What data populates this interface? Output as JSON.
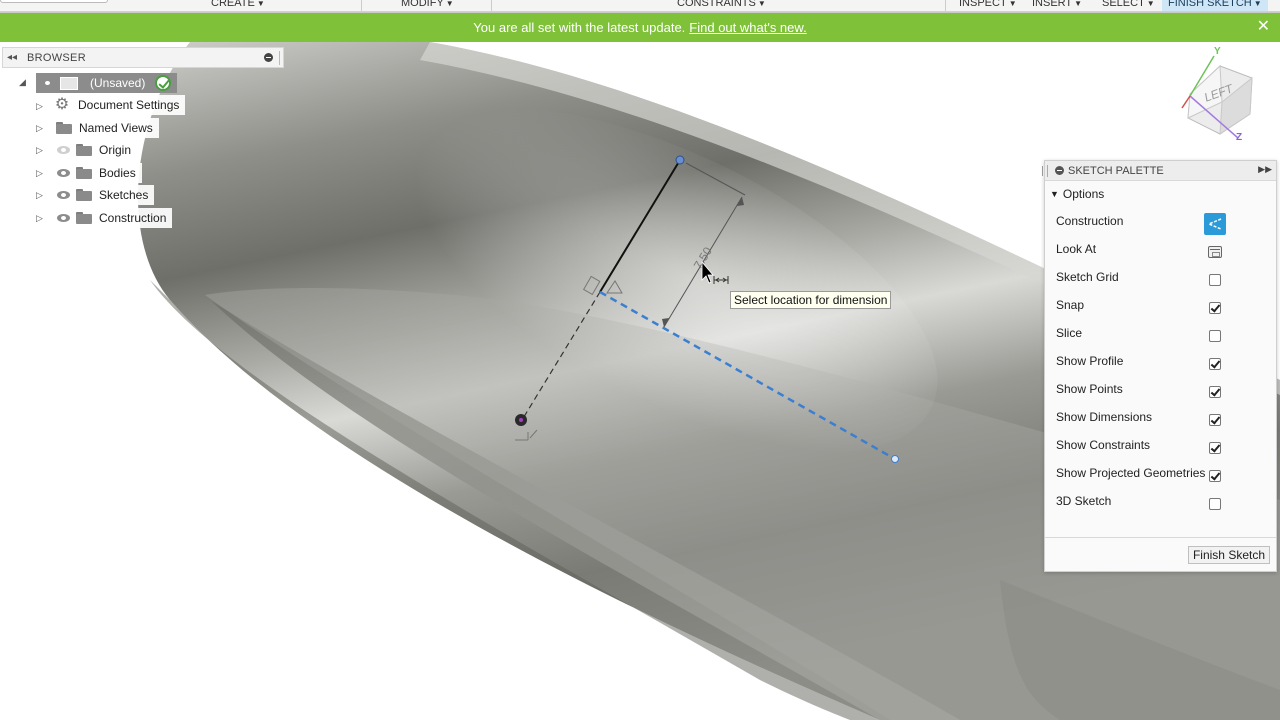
{
  "toolbar": {
    "menus": [
      {
        "label": "CREATE"
      },
      {
        "label": "MODIFY"
      },
      {
        "label": "CONSTRAINTS"
      },
      {
        "label": "INSPECT"
      },
      {
        "label": "INSERT"
      },
      {
        "label": "SELECT"
      },
      {
        "label": "FINISH SKETCH"
      }
    ]
  },
  "banner": {
    "message": "You are all set with the latest update.",
    "link": "Find out what's new.",
    "close": "✕",
    "color": "#7fc23a"
  },
  "browser": {
    "title": "BROWSER",
    "collapse_icon": "◂◂",
    "root_label": "(Unsaved)",
    "items": [
      {
        "label": "Document Settings",
        "icon": "gear-icon"
      },
      {
        "label": "Named Views",
        "icon": "folder-icon"
      },
      {
        "label": "Origin",
        "icon": "folder-icon",
        "visible": false
      },
      {
        "label": "Bodies",
        "icon": "folder-icon",
        "visible": true
      },
      {
        "label": "Sketches",
        "icon": "folder-icon",
        "visible": true
      },
      {
        "label": "Construction",
        "icon": "folder-icon",
        "visible": true
      }
    ]
  },
  "viewcube": {
    "face": "LEFT",
    "y_axis": "Y",
    "z_axis": "Z"
  },
  "dimension": {
    "value": "7.50"
  },
  "tooltip": {
    "text": "Select location for dimension"
  },
  "sketch_palette": {
    "title": "SKETCH PALETTE",
    "section": "Options",
    "options": [
      {
        "label": "Construction",
        "control": "construction-toggle",
        "active": true
      },
      {
        "label": "Look At",
        "control": "look-at-button"
      },
      {
        "label": "Sketch Grid",
        "control": "checkbox",
        "checked": false
      },
      {
        "label": "Snap",
        "control": "checkbox",
        "checked": true
      },
      {
        "label": "Slice",
        "control": "checkbox",
        "checked": false
      },
      {
        "label": "Show Profile",
        "control": "checkbox",
        "checked": true
      },
      {
        "label": "Show Points",
        "control": "checkbox",
        "checked": true
      },
      {
        "label": "Show Dimensions",
        "control": "checkbox",
        "checked": true
      },
      {
        "label": "Show Constraints",
        "control": "checkbox",
        "checked": true
      },
      {
        "label": "Show Projected Geometries",
        "control": "checkbox",
        "checked": true
      },
      {
        "label": "3D Sketch",
        "control": "checkbox",
        "checked": false
      }
    ],
    "finish_button": "Finish Sketch",
    "accent": "#2a9bd8"
  }
}
